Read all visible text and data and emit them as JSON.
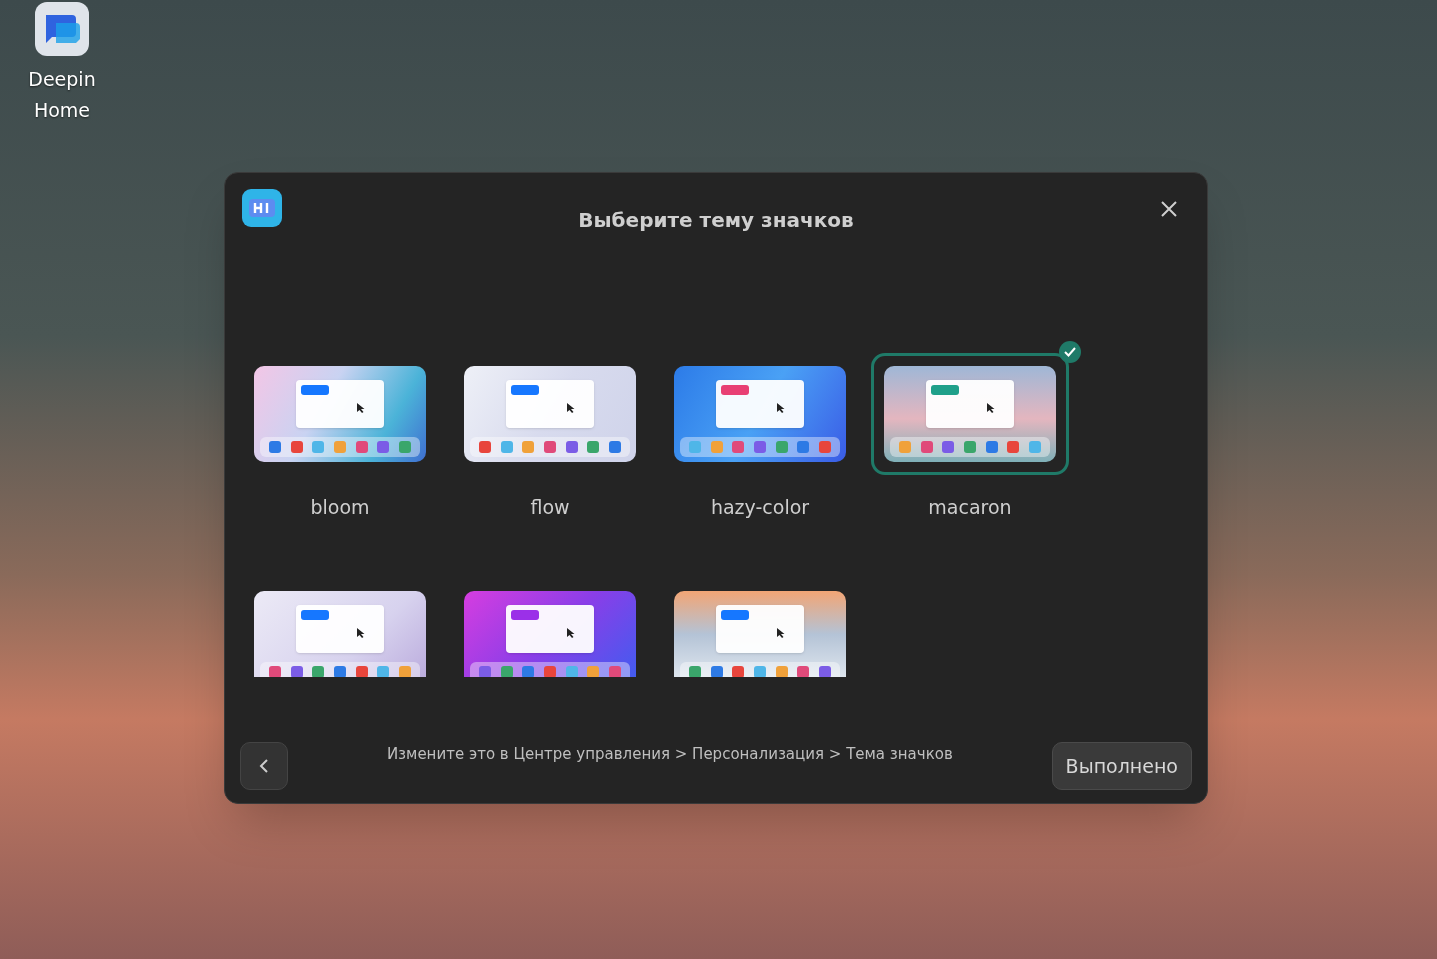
{
  "desktop": {
    "icons": [
      {
        "label": "Deepin Home"
      }
    ]
  },
  "dialog": {
    "title": "Выберите тему значков",
    "themes": [
      {
        "name": "bloom",
        "selected": false,
        "color": "#1677ff"
      },
      {
        "name": "flow",
        "selected": false,
        "color": "#1677ff"
      },
      {
        "name": "hazy-color",
        "selected": false,
        "color": "#e83f74"
      },
      {
        "name": "macaron",
        "selected": true,
        "color": "#1fa08a"
      },
      {
        "selected": false,
        "color": "#1677ff"
      },
      {
        "selected": false,
        "color": "#9b30e8"
      },
      {
        "selected": false,
        "color": "#1677ff"
      }
    ],
    "hint": "Измените это в Центре управления > Персонализация > Тема значков",
    "done_button": "Выполнено"
  }
}
